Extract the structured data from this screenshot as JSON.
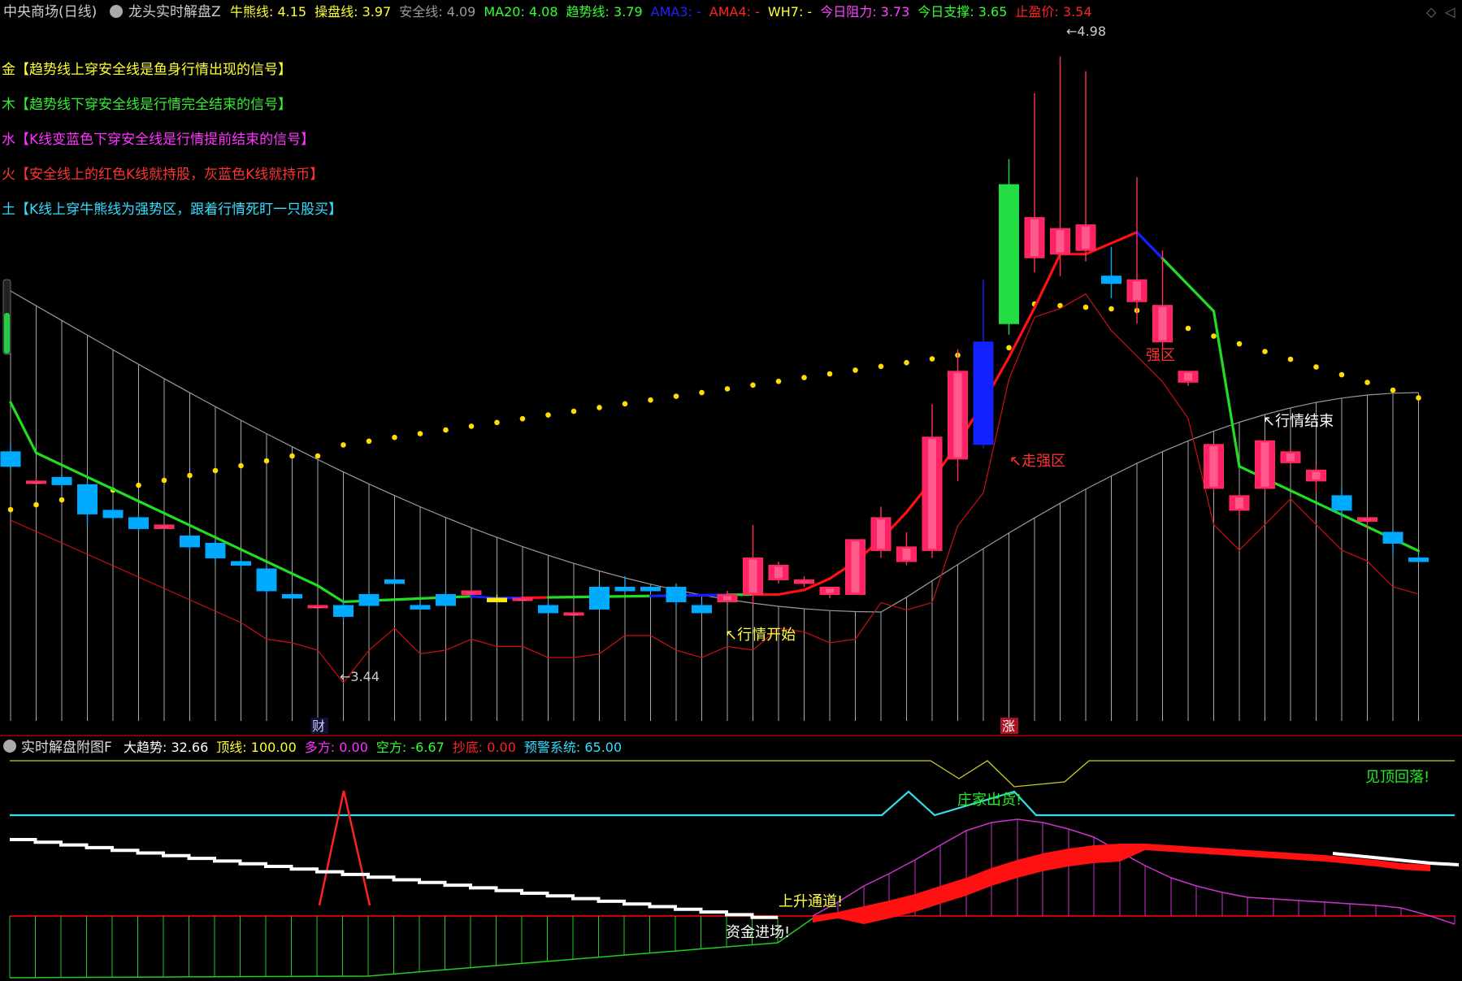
{
  "header": {
    "stock": "中央商场(日线)",
    "indicator": "龙头实时解盘Z",
    "items": [
      {
        "label": "牛熊线:",
        "value": "4.15",
        "color": "#ffff33"
      },
      {
        "label": "操盘线:",
        "value": "3.97",
        "color": "#ffff33"
      },
      {
        "label": "安全线:",
        "value": "4.09",
        "color": "#9a9a9a"
      },
      {
        "label": "MA20:",
        "value": "4.08",
        "color": "#33ff33"
      },
      {
        "label": "趋势线:",
        "value": "3.79",
        "color": "#33ff33"
      },
      {
        "label": "AMA3:",
        "value": "-",
        "color": "#2222ff"
      },
      {
        "label": "AMA4:",
        "value": "-",
        "color": "#ff2222"
      },
      {
        "label": "WH7:",
        "value": "-",
        "color": "#ffff33"
      },
      {
        "label": "今日阻力:",
        "value": "3.73",
        "color": "#ff44ff"
      },
      {
        "label": "今日支撑:",
        "value": "3.65",
        "color": "#33ff33"
      },
      {
        "label": "止盈价:",
        "value": "3.54",
        "color": "#ff2222"
      }
    ]
  },
  "notes": [
    {
      "text": "金【趋势线上穿安全线是鱼身行情出现的信号】",
      "color": "#ffff33"
    },
    {
      "text": "木【趋势线下穿安全线是行情完全结束的信号】",
      "color": "#33ee33"
    },
    {
      "text": "水【K线变蓝色下穿安全线是行情提前结束的信号】",
      "color": "#ff33ff"
    },
    {
      "text": "火【安全线上的红色K线就持股，灰蓝色K线就持币】",
      "color": "#ff3333"
    },
    {
      "text": "土【K线上穿牛熊线为强势区，跟着行情死盯一只股买】",
      "color": "#33ddff"
    }
  ],
  "annotations": {
    "high": "4.98",
    "low": "3.44",
    "start": "行情开始",
    "strong": "走强区",
    "strong2": "强区",
    "end": "行情结束",
    "cai": "财",
    "zhang": "涨"
  },
  "sub": {
    "title": "实时解盘附图F",
    "items": [
      {
        "label": "大趋势:",
        "value": "32.66",
        "color": "#ffffff"
      },
      {
        "label": "顶线:",
        "value": "100.00",
        "color": "#ffff33"
      },
      {
        "label": "多方:",
        "value": "0.00",
        "color": "#ff33ff"
      },
      {
        "label": "空方:",
        "value": "-6.67",
        "color": "#33ff33"
      },
      {
        "label": "抄底:",
        "value": "0.00",
        "color": "#ff2222"
      },
      {
        "label": "预警系统:",
        "value": "65.00",
        "color": "#33ddff"
      }
    ],
    "labels": {
      "top_fall": "见顶回落!",
      "dealer_out": "庄家出货!",
      "up_channel": "上升通道!",
      "funds_in": "资金进场!"
    }
  },
  "colors": {
    "up": "#ff3355",
    "up_body": "#ff3355",
    "down": "#00aaff",
    "blue_candle": "#1122ff",
    "green_candle": "#22dd44",
    "bg": "#000000"
  },
  "chart_data": {
    "type": "candlestick",
    "ylim": [
      3.3,
      5.05
    ],
    "candles": [
      [
        3.9,
        3.92,
        3.85,
        3.86
      ],
      [
        3.82,
        3.83,
        3.81,
        3.82
      ],
      [
        3.83,
        3.84,
        3.8,
        3.81
      ],
      [
        3.81,
        3.82,
        3.7,
        3.73
      ],
      [
        3.74,
        3.75,
        3.71,
        3.72
      ],
      [
        3.72,
        3.73,
        3.68,
        3.69
      ],
      [
        3.69,
        3.7,
        3.69,
        3.7
      ],
      [
        3.67,
        3.68,
        3.63,
        3.64
      ],
      [
        3.65,
        3.66,
        3.6,
        3.61
      ],
      [
        3.6,
        3.61,
        3.58,
        3.59
      ],
      [
        3.58,
        3.59,
        3.51,
        3.52
      ],
      [
        3.51,
        3.52,
        3.5,
        3.5
      ],
      [
        3.48,
        3.49,
        3.48,
        3.48
      ],
      [
        3.48,
        3.49,
        3.44,
        3.45
      ],
      [
        3.51,
        3.52,
        3.47,
        3.48
      ],
      [
        3.55,
        3.56,
        3.54,
        3.54
      ],
      [
        3.48,
        3.49,
        3.47,
        3.47
      ],
      [
        3.51,
        3.52,
        3.48,
        3.48
      ],
      [
        3.51,
        3.52,
        3.51,
        3.52
      ],
      [
        3.5,
        3.51,
        3.49,
        3.49
      ],
      [
        3.5,
        3.51,
        3.49,
        3.5
      ],
      [
        3.48,
        3.49,
        3.46,
        3.46
      ],
      [
        3.46,
        3.47,
        3.46,
        3.46
      ],
      [
        3.53,
        3.54,
        3.47,
        3.47
      ],
      [
        3.53,
        3.56,
        3.52,
        3.52
      ],
      [
        3.53,
        3.54,
        3.52,
        3.52
      ],
      [
        3.53,
        3.54,
        3.48,
        3.49
      ],
      [
        3.48,
        3.49,
        3.46,
        3.46
      ],
      [
        3.49,
        3.52,
        3.49,
        3.51
      ],
      [
        3.51,
        3.7,
        3.48,
        3.61
      ],
      [
        3.55,
        3.6,
        3.54,
        3.59
      ],
      [
        3.54,
        3.56,
        3.53,
        3.55
      ],
      [
        3.51,
        3.53,
        3.5,
        3.53
      ],
      [
        3.51,
        3.66,
        3.51,
        3.66
      ],
      [
        3.63,
        3.75,
        3.61,
        3.72
      ],
      [
        3.6,
        3.68,
        3.59,
        3.64
      ],
      [
        3.63,
        4.03,
        3.61,
        3.94
      ],
      [
        3.88,
        4.18,
        3.82,
        4.12
      ],
      [
        3.92,
        4.37,
        3.91,
        4.2
      ],
      [
        4.25,
        4.7,
        4.22,
        4.63
      ],
      [
        4.43,
        4.88,
        4.39,
        4.54
      ],
      [
        4.44,
        4.98,
        4.38,
        4.51
      ],
      [
        4.45,
        4.94,
        4.42,
        4.52
      ],
      [
        4.38,
        4.46,
        4.32,
        4.36
      ],
      [
        4.31,
        4.65,
        4.25,
        4.37
      ],
      [
        4.2,
        4.45,
        4.18,
        4.3
      ],
      [
        4.09,
        4.12,
        4.08,
        4.12
      ],
      [
        3.8,
        3.92,
        3.79,
        3.92
      ],
      [
        3.74,
        3.74,
        3.72,
        3.78
      ],
      [
        3.8,
        3.92,
        3.79,
        3.93
      ],
      [
        3.87,
        3.91,
        3.86,
        3.9
      ],
      [
        3.82,
        3.86,
        3.79,
        3.85
      ],
      [
        3.78,
        3.8,
        3.72,
        3.74
      ],
      [
        3.71,
        3.72,
        3.69,
        3.72
      ],
      [
        3.68,
        3.69,
        3.62,
        3.65
      ],
      [
        3.61,
        3.62,
        3.6,
        3.6
      ]
    ],
    "special_candles": {
      "19": "yellow",
      "38": "blue",
      "39": "green"
    }
  }
}
